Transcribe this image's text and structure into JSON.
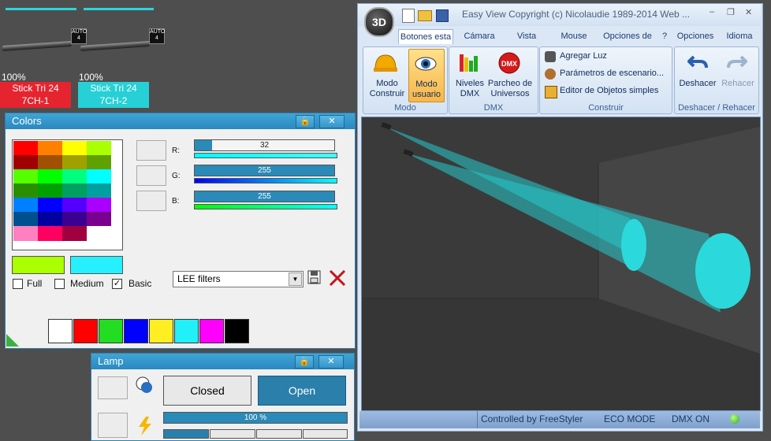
{
  "fixtures": [
    {
      "percent": "100%",
      "name": "Stick Tri 24",
      "channel": "7CH-1",
      "color": "#e5242f",
      "auto_label": "AUTO\n4"
    },
    {
      "percent": "100%",
      "name": "Stick Tri 24",
      "channel": "7CH-2",
      "color": "#26d0d6",
      "auto_label": "AUTO\n4"
    }
  ],
  "colors_panel": {
    "title": "Colors",
    "lock_icon": "lock-icon",
    "close_icon": "close-icon",
    "palette": [
      "#ff0000",
      "#ff7f00",
      "#ffff00",
      "#aaff00",
      "#a00000",
      "#a05000",
      "#a0a000",
      "#60a000",
      "#55ff00",
      "#00ff00",
      "#00ff7f",
      "#00ffff",
      "#2a8f00",
      "#00a000",
      "#00a060",
      "#00a0a0",
      "#0080ff",
      "#0000ff",
      "#5500ff",
      "#aa00ff",
      "#00508f",
      "#0000a0",
      "#3b0090",
      "#7a0090",
      "#ff80c0",
      "#ff0060",
      "#a00040",
      "#ffffff"
    ],
    "current_primary": "#aaff00",
    "current_secondary": "#26f0ff",
    "r_label": "R:",
    "g_label": "G:",
    "b_label": "B:",
    "r_value": "32",
    "g_value": "255",
    "b_value": "255",
    "r_fraction": 0.125,
    "g_fraction": 1.0,
    "b_fraction": 1.0,
    "checkbox_full": "Full",
    "checkbox_medium": "Medium",
    "checkbox_basic": "Basic",
    "basic_checked": "✓",
    "filter_select": "LEE filters",
    "quick_colors": [
      "#ffffff",
      "#ff0000",
      "#22dd22",
      "#0000ff",
      "#ffee22",
      "#22f0f8",
      "#ff00ff",
      "#000000"
    ]
  },
  "lamp_panel": {
    "title": "Lamp",
    "closed_label": "Closed",
    "open_label": "Open",
    "dimmer_value": "100 %"
  },
  "app": {
    "logo_text": "3D",
    "title": "Easy View  Copyright (c) Nicolaudie 1989-2014  Web ...",
    "window_buttons": [
      "–",
      "❐",
      "✕"
    ],
    "tabs": [
      "Botones esta",
      "Cámara",
      "Vista",
      "Mouse",
      "Opciones de",
      "?",
      "Opciones",
      "Idioma"
    ],
    "groups": {
      "modo": {
        "label": "Modo",
        "construir": "Modo\nConstruir",
        "usuario": "Modo\nusuario"
      },
      "dmx": {
        "label": "DMX",
        "niveles": "Niveles\nDMX",
        "parcheo": "Parcheo de\nUniversos"
      },
      "construir": {
        "label": "Construir",
        "agregar": "Agregar Luz",
        "parametros": "Parámetros de escenario...",
        "editor": "Editor de Objetos simples"
      },
      "deshacer": {
        "label": "Deshacer / Rehacer",
        "undo": "Deshacer",
        "redo": "Rehacer"
      }
    },
    "status": {
      "controlled": "Controlled by FreeStyler",
      "eco": "ECO MODE",
      "dmx": "DMX ON"
    }
  }
}
